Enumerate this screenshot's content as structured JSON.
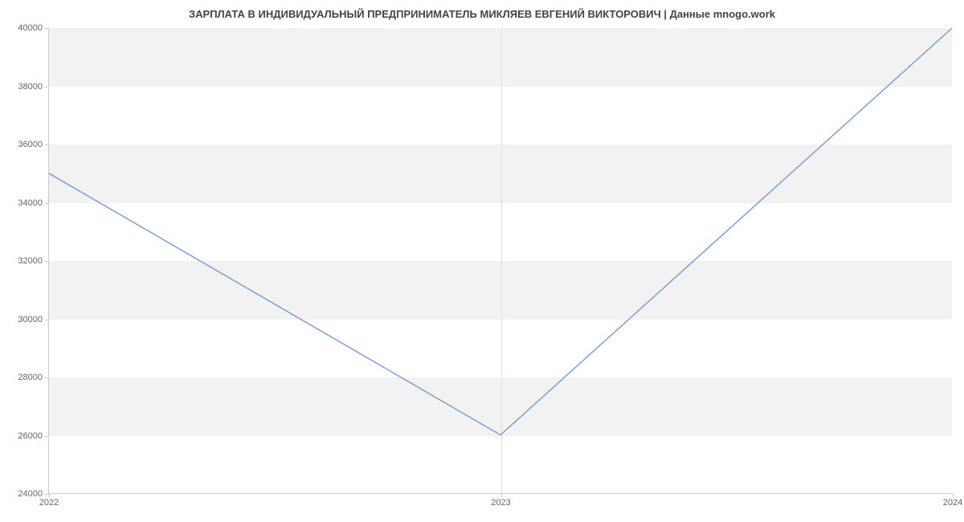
{
  "chart_data": {
    "type": "line",
    "title": "ЗАРПЛАТА В ИНДИВИДУАЛЬНЫЙ ПРЕДПРИНИМАТЕЛЬ МИКЛЯЕВ ЕВГЕНИЙ ВИКТОРОВИЧ | Данные mnogo.work",
    "x": [
      2022,
      2023,
      2024
    ],
    "values": [
      35000,
      26000,
      40000
    ],
    "xlabel": "",
    "ylabel": "",
    "xlim": [
      2022,
      2024
    ],
    "ylim": [
      24000,
      40000
    ],
    "y_ticks": [
      24000,
      26000,
      28000,
      30000,
      32000,
      34000,
      36000,
      38000,
      40000
    ],
    "x_ticks": [
      2022,
      2023,
      2024
    ]
  }
}
